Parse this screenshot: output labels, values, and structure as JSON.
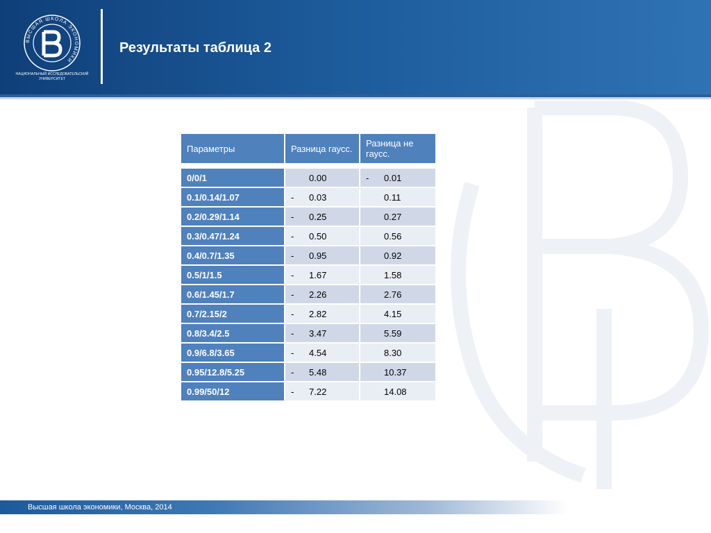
{
  "header": {
    "title": "Результаты таблица 2",
    "logo_caption": "НАЦИОНАЛЬНЫЙ ИССЛЕДОВАТЕЛЬСКИЙ УНИВЕРСИТЕТ",
    "logo_ring_text": "ВЫСШАЯ ШКОЛА ЭКОНОМИКИ"
  },
  "table": {
    "headers": [
      "Параметры",
      "Разница гаусс.",
      "Разница не гаусс."
    ],
    "rows": [
      {
        "param": "0/0/1",
        "gauss_sign": "",
        "gauss": "0.00",
        "nongauss_sign": "-",
        "nongauss": "0.01"
      },
      {
        "param": "0.1/0.14/1.07",
        "gauss_sign": "-",
        "gauss": "0.03",
        "nongauss_sign": "",
        "nongauss": "0.11"
      },
      {
        "param": "0.2/0.29/1.14",
        "gauss_sign": "-",
        "gauss": "0.25",
        "nongauss_sign": "",
        "nongauss": "0.27"
      },
      {
        "param": "0.3/0.47/1.24",
        "gauss_sign": "-",
        "gauss": "0.50",
        "nongauss_sign": "",
        "nongauss": "0.56"
      },
      {
        "param": "0.4/0.7/1.35",
        "gauss_sign": "-",
        "gauss": "0.95",
        "nongauss_sign": "",
        "nongauss": "0.92"
      },
      {
        "param": "0.5/1/1.5",
        "gauss_sign": "-",
        "gauss": "1.67",
        "nongauss_sign": "",
        "nongauss": "1.58"
      },
      {
        "param": "0.6/1.45/1.7",
        "gauss_sign": "-",
        "gauss": "2.26",
        "nongauss_sign": "",
        "nongauss": "2.76"
      },
      {
        "param": "0.7/2.15/2",
        "gauss_sign": "-",
        "gauss": "2.82",
        "nongauss_sign": "",
        "nongauss": "4.15"
      },
      {
        "param": "0.8/3.4/2.5",
        "gauss_sign": "-",
        "gauss": "3.47",
        "nongauss_sign": "",
        "nongauss": "5.59"
      },
      {
        "param": "0.9/6.8/3.65",
        "gauss_sign": "-",
        "gauss": "4.54",
        "nongauss_sign": "",
        "nongauss": "8.30"
      },
      {
        "param": "0.95/12.8/5.25",
        "gauss_sign": "-",
        "gauss": "5.48",
        "nongauss_sign": "",
        "nongauss": "10.37"
      },
      {
        "param": "0.99/50/12",
        "gauss_sign": "-",
        "gauss": "7.22",
        "nongauss_sign": "",
        "nongauss": "14.08"
      }
    ]
  },
  "footer": {
    "text": "Высшая школа экономики, Москва, 2014"
  },
  "colors": {
    "header_blue": "#1c5a9a",
    "table_header": "#4f81bd",
    "row_odd": "#d0d8e8",
    "row_even": "#e9edf4"
  }
}
